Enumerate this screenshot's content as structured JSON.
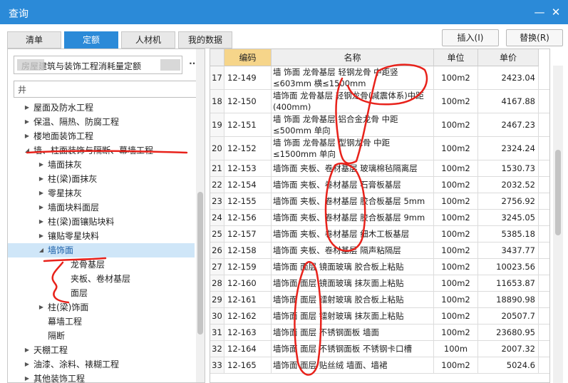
{
  "window": {
    "title": "查询"
  },
  "tabs": [
    "清单",
    "定额",
    "人材机",
    "我的数据"
  ],
  "active_tab": 1,
  "actions": {
    "insert": "插入(I)",
    "replace": "替换(R)"
  },
  "source": {
    "value": "房屋建筑与装饰工程消耗量定额",
    "more": "···"
  },
  "search": {
    "value": "井"
  },
  "tree": [
    {
      "label": "屋面及防水工程",
      "level": 0,
      "arrow": "right"
    },
    {
      "label": "保温、隔热、防腐工程",
      "level": 0,
      "arrow": "right"
    },
    {
      "label": "楼地面装饰工程",
      "level": 0,
      "arrow": "right"
    },
    {
      "label": "墙、柱面装饰与隔断、幕墙工程",
      "level": 0,
      "arrow": "down"
    },
    {
      "label": "墙面抹灰",
      "level": 1,
      "arrow": "right"
    },
    {
      "label": "柱(梁)面抹灰",
      "level": 1,
      "arrow": "right"
    },
    {
      "label": "零星抹灰",
      "level": 1,
      "arrow": "right"
    },
    {
      "label": "墙面块料面层",
      "level": 1,
      "arrow": "right"
    },
    {
      "label": "柱(梁)面镶贴块料",
      "level": 1,
      "arrow": "right"
    },
    {
      "label": "镶贴零星块料",
      "level": 1,
      "arrow": "right"
    },
    {
      "label": "墙饰面",
      "level": 1,
      "arrow": "down",
      "selected": true
    },
    {
      "label": "龙骨基层",
      "level": 2,
      "arrow": ""
    },
    {
      "label": "夹板、卷材基层",
      "level": 2,
      "arrow": ""
    },
    {
      "label": "面层",
      "level": 2,
      "arrow": ""
    },
    {
      "label": "柱(梁)饰面",
      "level": 1,
      "arrow": "right"
    },
    {
      "label": "幕墙工程",
      "level": 1,
      "arrow": ""
    },
    {
      "label": "隔断",
      "level": 1,
      "arrow": ""
    },
    {
      "label": "天棚工程",
      "level": 0,
      "arrow": "right"
    },
    {
      "label": "油漆、涂料、裱糊工程",
      "level": 0,
      "arrow": "right"
    },
    {
      "label": "其他装饰工程",
      "level": 0,
      "arrow": "right"
    }
  ],
  "table": {
    "headers": [
      "",
      "编码",
      "名称",
      "单位",
      "单价"
    ],
    "rows": [
      [
        "17",
        "12-149",
        "墙 饰面 龙骨基层 轻钢龙骨 中距竖≤603mm 横≤1500mm",
        "100m2",
        "2423.04"
      ],
      [
        "18",
        "12-150",
        "墙饰面 龙骨基层 轻钢龙骨(减震体系)中距(400mm)",
        "100m2",
        "4167.88"
      ],
      [
        "19",
        "12-151",
        "墙 饰面 龙骨基层 铝合金龙骨 中距≤500mm 单向",
        "100m2",
        "2467.23"
      ],
      [
        "20",
        "12-152",
        "墙 饰面 龙骨基层 型钢龙骨 中距≤1500mm 单向",
        "100m2",
        "2324.24"
      ],
      [
        "21",
        "12-153",
        "墙饰面 夹板、卷材基层 玻璃棉毡隔离层",
        "100m2",
        "1530.73"
      ],
      [
        "22",
        "12-154",
        "墙饰面 夹板、卷材基层 石膏板基层",
        "100m2",
        "2032.52"
      ],
      [
        "23",
        "12-155",
        "墙饰面 夹板、卷材基层 胶合板基层 5mm",
        "100m2",
        "2756.92"
      ],
      [
        "24",
        "12-156",
        "墙饰面 夹板、卷材基层 胶合板基层 9mm",
        "100m2",
        "3245.05"
      ],
      [
        "25",
        "12-157",
        "墙饰面 夹板、卷材基层 细木工板基层",
        "100m2",
        "5385.18"
      ],
      [
        "26",
        "12-158",
        "墙饰面 夹板、卷材基层 隔声粘隔层",
        "100m2",
        "3437.77"
      ],
      [
        "27",
        "12-159",
        "墙饰面 面层 镜面玻璃 胶合板上粘贴",
        "100m2",
        "10023.56"
      ],
      [
        "28",
        "12-160",
        "墙饰面 面层 镜面玻璃 抹灰面上粘贴",
        "100m2",
        "11653.87"
      ],
      [
        "29",
        "12-161",
        "墙饰面 面层 镭射玻璃 胶合板上粘贴",
        "100m2",
        "18890.98"
      ],
      [
        "30",
        "12-162",
        "墙饰面 面层 镭射玻璃 抹灰面上粘贴",
        "100m2",
        "20507.7"
      ],
      [
        "31",
        "12-163",
        "墙饰面 面层 不锈钢面板 墙面",
        "100m2",
        "23680.95"
      ],
      [
        "32",
        "12-164",
        "墙饰面 面层 不锈钢面板 不锈钢卡口槽",
        "100m",
        "2007.32"
      ],
      [
        "33",
        "12-165",
        "墙饰面 面层 贴丝绒 墙面、墙裙",
        "100m2",
        "5024.6"
      ]
    ]
  },
  "colors": {
    "titlebar": "#2b8ad8",
    "selected": "#cfe6f8",
    "sorted_header": "#f6d58a",
    "annotation": "#e8221b"
  },
  "icons": [
    "minimize-icon",
    "close-icon",
    "expand-arrow-icon",
    "collapse-arrow-icon"
  ]
}
